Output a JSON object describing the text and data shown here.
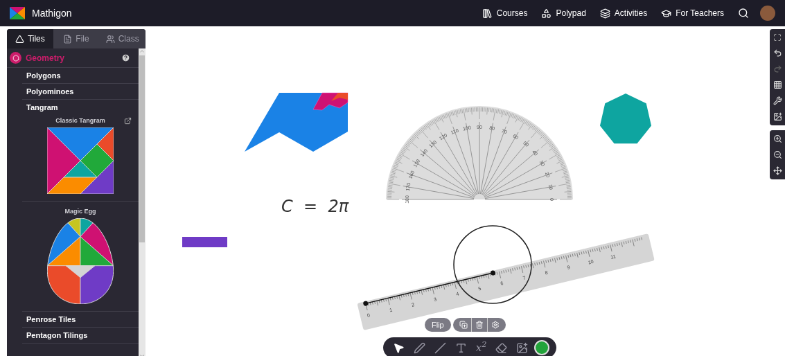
{
  "top_bar": {
    "brand": "Mathigon",
    "nav": [
      {
        "label": "Courses",
        "kind": "courses"
      },
      {
        "label": "Polypad",
        "kind": "polypad"
      },
      {
        "label": "Activities",
        "kind": "activities"
      },
      {
        "label": "For Teachers",
        "kind": "teachers"
      }
    ]
  },
  "sidebar": {
    "tabs": [
      {
        "label": "Tiles",
        "kind": "tiles",
        "selected": true
      },
      {
        "label": "File",
        "kind": "file",
        "selected": false
      },
      {
        "label": "Class",
        "kind": "class",
        "selected": false
      }
    ],
    "category": "Geometry",
    "items": [
      {
        "label": "Polygons"
      },
      {
        "label": "Polyominoes"
      },
      {
        "label": "Tangram",
        "children": [
          {
            "label": "Classic Tangram",
            "kind": "tangram"
          },
          {
            "label": "Magic Egg",
            "kind": "egg"
          }
        ]
      },
      {
        "label": "Penrose Tiles"
      },
      {
        "label": "Pentagon Tilings"
      }
    ]
  },
  "canvas": {
    "formula": "C  =  2π",
    "protractor_labels": [
      "0",
      "10",
      "20",
      "30",
      "40",
      "50",
      "60",
      "70",
      "80",
      "90",
      "100",
      "110",
      "120",
      "130",
      "140",
      "150",
      "160",
      "170",
      "180"
    ],
    "ruler_labels": [
      "0",
      "1",
      "2",
      "3",
      "4",
      "5",
      "6",
      "7",
      "8",
      "9",
      "10",
      "11"
    ]
  },
  "right_toolbar": {
    "redo": {
      "disabled": true
    }
  },
  "selection_toolbar": {
    "flip": "Flip"
  },
  "tools": [
    {
      "kind": "select",
      "selected": true
    },
    {
      "kind": "pen",
      "selected": false
    },
    {
      "kind": "line",
      "selected": false
    },
    {
      "kind": "text",
      "selected": false
    },
    {
      "kind": "equation",
      "label": "x$^{2}$",
      "selected": false
    },
    {
      "kind": "eraser",
      "selected": false
    },
    {
      "kind": "image",
      "selected": false
    },
    {
      "kind": "color",
      "color": "#22a33a"
    }
  ]
}
